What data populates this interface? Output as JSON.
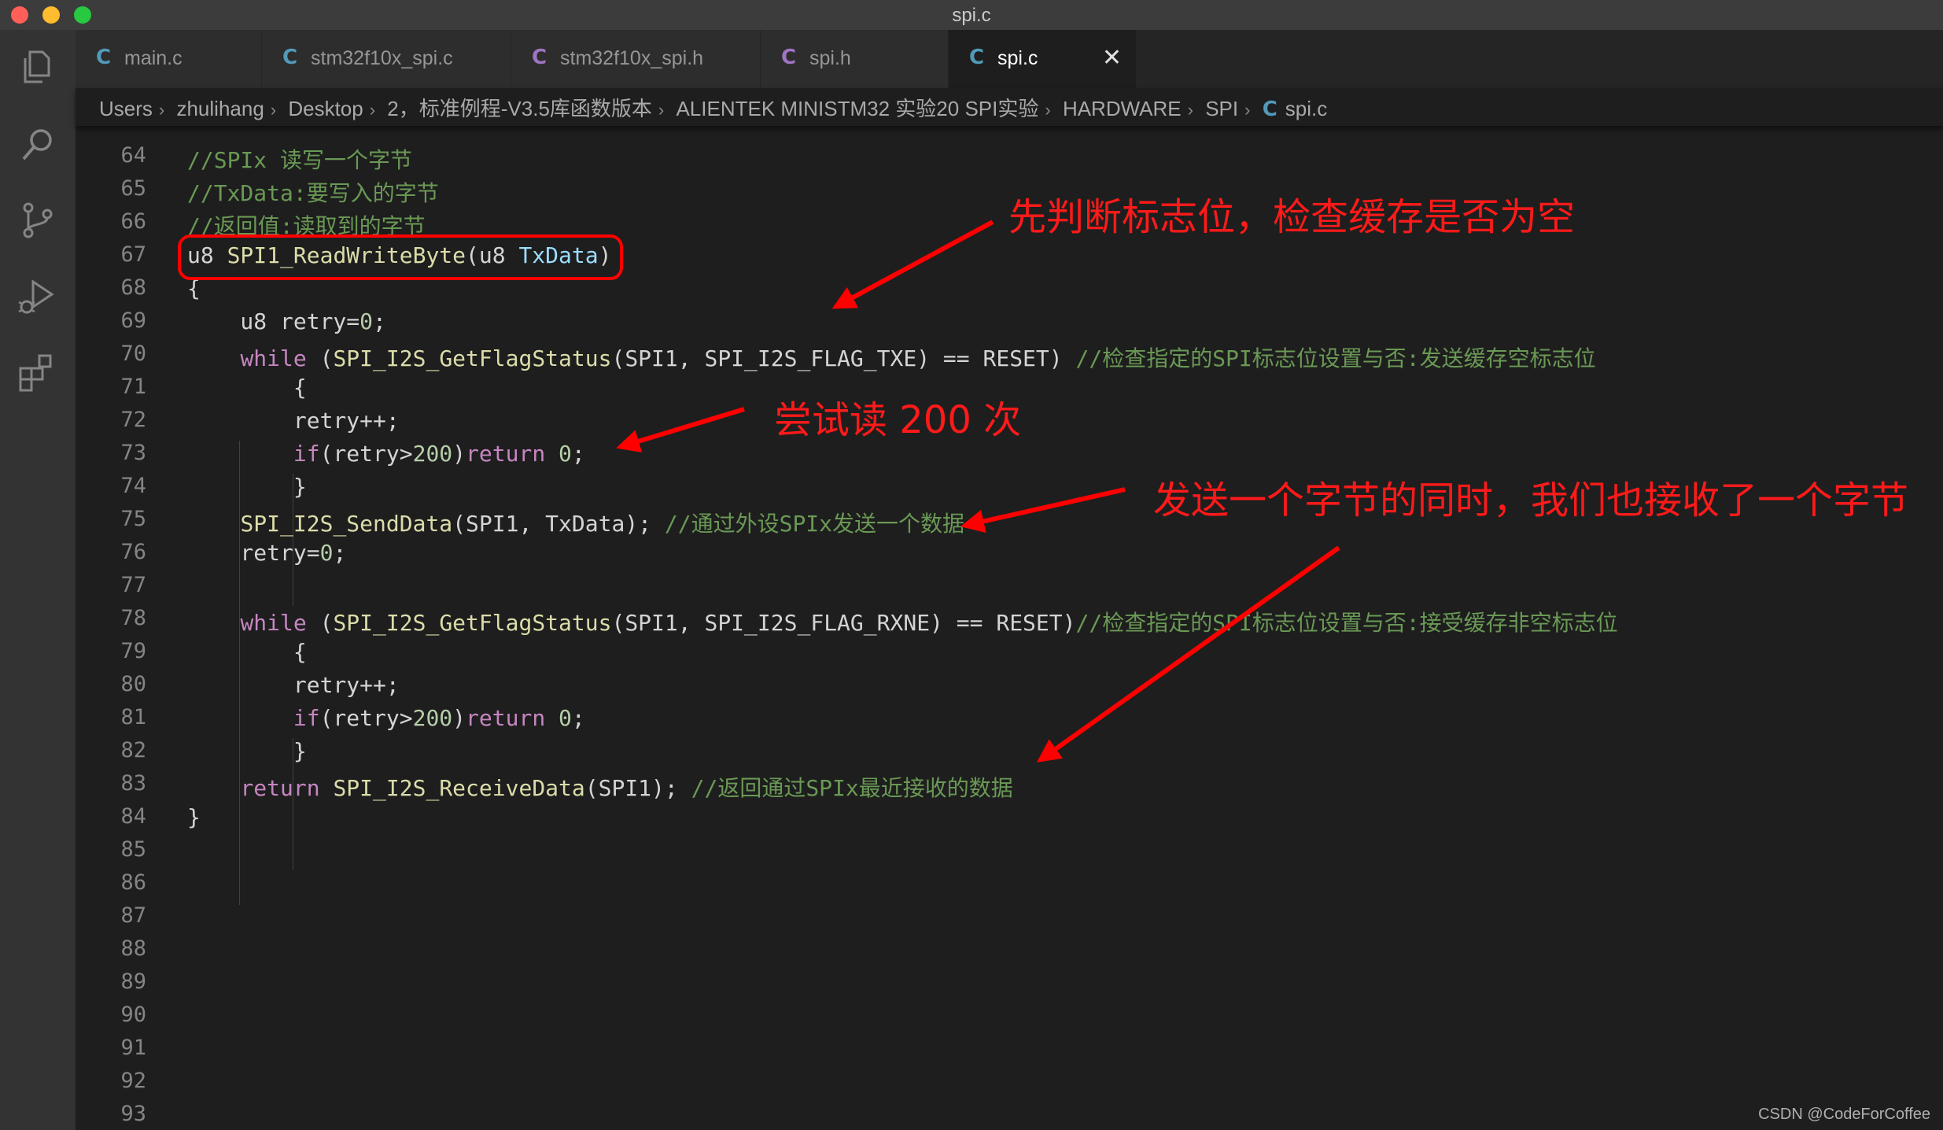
{
  "window": {
    "title": "spi.c"
  },
  "tabs": [
    {
      "icon": "C",
      "label": "main.c",
      "icon_color": "#519aba"
    },
    {
      "icon": "C",
      "label": "stm32f10x_spi.c",
      "icon_color": "#519aba"
    },
    {
      "icon": "C",
      "label": "stm32f10x_spi.h",
      "icon_color": "#a074c4"
    },
    {
      "icon": "C",
      "label": "spi.h",
      "icon_color": "#a074c4"
    },
    {
      "icon": "C",
      "label": "spi.c",
      "icon_color": "#519aba",
      "close": "✕"
    }
  ],
  "breadcrumb": {
    "items": [
      "Users",
      "zhulihang",
      "Desktop",
      "2，标准例程-V3.5库函数版本",
      "ALIENTEK MINISTM32 实验20 SPI实验",
      "HARDWARE",
      "SPI"
    ],
    "file_icon": "C",
    "file": "spi.c"
  },
  "editor": {
    "lines": [
      {
        "n": "64",
        "html": "<span class=\"cm\">//SPIx 读写一个字节</span>"
      },
      {
        "n": "65",
        "html": "<span class=\"cm\">//TxData:要写入的字节</span>"
      },
      {
        "n": "66",
        "html": "<span class=\"cm\">//返回值:读取到的字节</span>"
      },
      {
        "n": "67",
        "html": "u8 <span class=\"fn\">SPI1_ReadWriteByte</span>(u8 <span class=\"par\">TxData</span>)"
      },
      {
        "n": "68",
        "html": "{"
      },
      {
        "n": "69",
        "html": "    u8 retry=<span class=\"num\">0</span>;"
      },
      {
        "n": "70",
        "html": "    <span class=\"kw\">while</span> (<span class=\"fn\">SPI_I2S_GetFlagStatus</span>(SPI1, SPI_I2S_FLAG_TXE) == RESET) <span class=\"cm\">//检查指定的SPI标志位设置与否:发送缓存空标志位</span>"
      },
      {
        "n": "71",
        "html": "        {"
      },
      {
        "n": "72",
        "html": "        retry++;"
      },
      {
        "n": "73",
        "html": "        <span class=\"kw\">if</span>(retry><span class=\"num\">200</span>)<span class=\"kw\">return</span> <span class=\"num\">0</span>;"
      },
      {
        "n": "74",
        "html": "        }"
      },
      {
        "n": "75",
        "html": "    <span class=\"fn\">SPI_I2S_SendData</span>(SPI1, TxData); <span class=\"cm\">//通过外设SPIx发送一个数据</span>"
      },
      {
        "n": "76",
        "html": "    retry=<span class=\"num\">0</span>;"
      },
      {
        "n": "77",
        "html": ""
      },
      {
        "n": "78",
        "html": "    <span class=\"kw\">while</span> (<span class=\"fn\">SPI_I2S_GetFlagStatus</span>(SPI1, SPI_I2S_FLAG_RXNE) == RESET)<span class=\"cm\">//检查指定的SPI标志位设置与否:接受缓存非空标志位</span>"
      },
      {
        "n": "79",
        "html": "        {"
      },
      {
        "n": "80",
        "html": "        retry++;"
      },
      {
        "n": "81",
        "html": "        <span class=\"kw\">if</span>(retry><span class=\"num\">200</span>)<span class=\"kw\">return</span> <span class=\"num\">0</span>;"
      },
      {
        "n": "82",
        "html": "        }"
      },
      {
        "n": "83",
        "html": "    <span class=\"kw\">return</span> <span class=\"fn\">SPI_I2S_ReceiveData</span>(SPI1); <span class=\"cm\">//返回通过SPIx最近接收的数据</span>"
      },
      {
        "n": "84",
        "html": "}"
      },
      {
        "n": "85",
        "html": ""
      },
      {
        "n": "86",
        "html": ""
      },
      {
        "n": "87",
        "html": ""
      },
      {
        "n": "88",
        "html": ""
      },
      {
        "n": "89",
        "html": ""
      },
      {
        "n": "90",
        "html": ""
      },
      {
        "n": "91",
        "html": ""
      },
      {
        "n": "92",
        "html": ""
      },
      {
        "n": "93",
        "html": ""
      }
    ]
  },
  "annotations": {
    "flag_check": "先判断标志位，检查缓存是否为空",
    "retry": "尝试读 200 次",
    "send_receive": "发送一个字节的同时，我们也接收了一个字节"
  },
  "watermark": "CSDN @CodeForCoffee",
  "colors": {
    "annotation": "#ff0000",
    "comment": "#6a9955",
    "keyword": "#c586c0",
    "function": "#dcdcaa"
  },
  "activity_icons": [
    "explorer-icon",
    "search-icon",
    "source-control-icon",
    "run-debug-icon",
    "extensions-icon"
  ]
}
